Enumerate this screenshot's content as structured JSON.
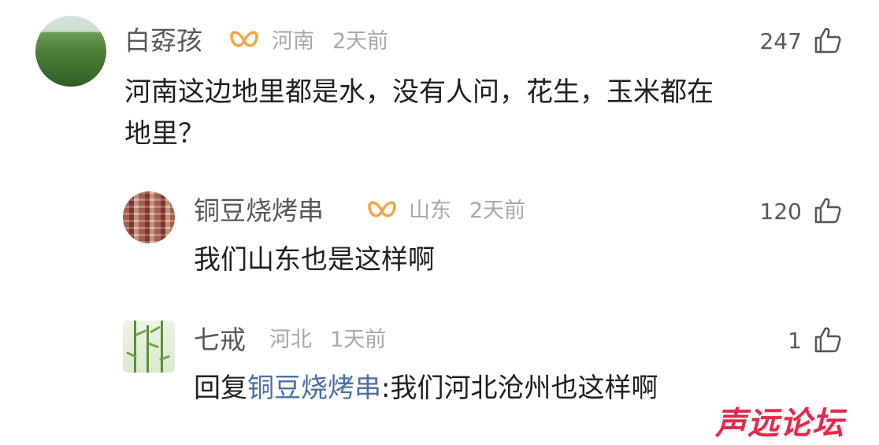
{
  "comments": [
    {
      "user": "白孬孩",
      "location": "河南",
      "time": "2天前",
      "likes": "247",
      "text_line1": "河南这边地里都是水，没有人问，花生，玉米都在",
      "text_line2": "地里？",
      "badge_icon": "vip-badge-icon"
    },
    {
      "user": "铜豆烧烤串",
      "location": "山东",
      "time": "2天前",
      "likes": "120",
      "text": "我们山东也是这样啊",
      "badge_icon": "vip-badge-icon"
    },
    {
      "user": "七戒",
      "location": "河北",
      "time": "1天前",
      "likes": "1",
      "reply_prefix": "回复",
      "reply_to": "铜豆烧烤串",
      "text": ":我们河北沧州也这样啊"
    }
  ],
  "watermark": "声远论坛",
  "colors": {
    "badge": "#f0a640",
    "watermark": "#e8274a",
    "reply_link": "#4a6fa5"
  },
  "icons": {
    "like": "thumbs-up-icon"
  }
}
